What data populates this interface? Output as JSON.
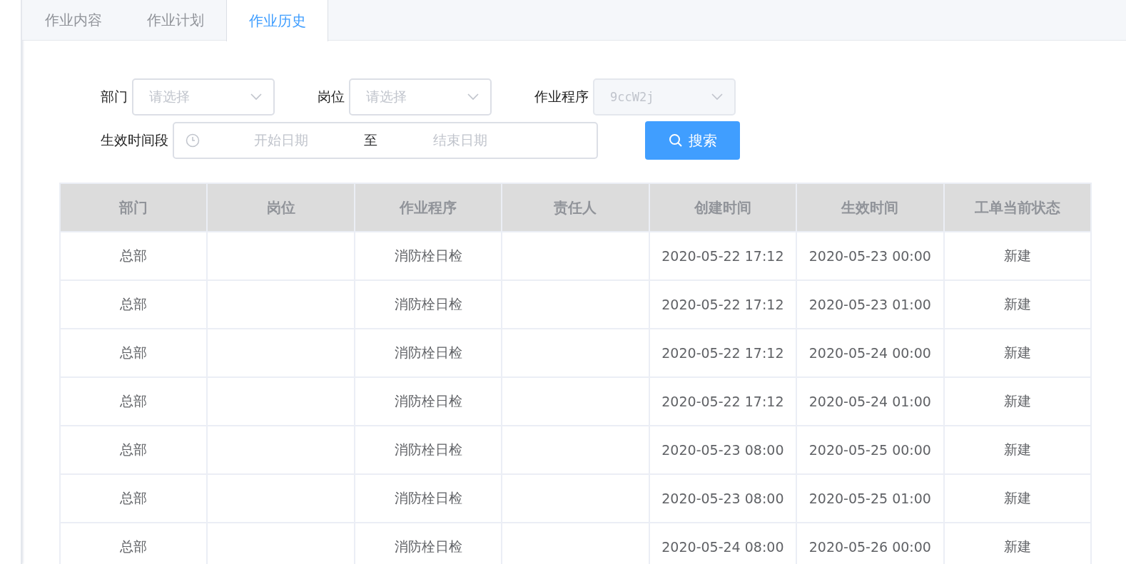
{
  "tabs": [
    {
      "label": "作业内容",
      "selected": false
    },
    {
      "label": "作业计划",
      "selected": false
    },
    {
      "label": "作业历史",
      "selected": true
    }
  ],
  "filters": {
    "department": {
      "label": "部门",
      "placeholder": "请选择"
    },
    "position": {
      "label": "岗位",
      "placeholder": "请选择"
    },
    "program": {
      "label": "作业程序",
      "placeholder": "9ccW2j",
      "disabled": true
    },
    "period": {
      "label": "生效时间段",
      "start_placeholder": "开始日期",
      "separator": "至",
      "end_placeholder": "结束日期"
    },
    "search_button": "搜索"
  },
  "table": {
    "columns": [
      "部门",
      "岗位",
      "作业程序",
      "责任人",
      "创建时间",
      "生效时间",
      "工单当前状态"
    ],
    "rows": [
      {
        "department": "总部",
        "program": "消防栓日检",
        "created": "2020-05-22 17:12",
        "effective": "2020-05-23 00:00",
        "status": "新建"
      },
      {
        "department": "总部",
        "program": "消防栓日检",
        "created": "2020-05-22 17:12",
        "effective": "2020-05-23 01:00",
        "status": "新建"
      },
      {
        "department": "总部",
        "program": "消防栓日检",
        "created": "2020-05-22 17:12",
        "effective": "2020-05-24 00:00",
        "status": "新建"
      },
      {
        "department": "总部",
        "program": "消防栓日检",
        "created": "2020-05-22 17:12",
        "effective": "2020-05-24 01:00",
        "status": "新建"
      },
      {
        "department": "总部",
        "program": "消防栓日检",
        "created": "2020-05-23 08:00",
        "effective": "2020-05-25 00:00",
        "status": "新建"
      },
      {
        "department": "总部",
        "program": "消防栓日检",
        "created": "2020-05-23 08:00",
        "effective": "2020-05-25 01:00",
        "status": "新建"
      },
      {
        "department": "总部",
        "program": "消防栓日检",
        "created": "2020-05-24 08:00",
        "effective": "2020-05-26 00:00",
        "status": "新建"
      }
    ]
  }
}
